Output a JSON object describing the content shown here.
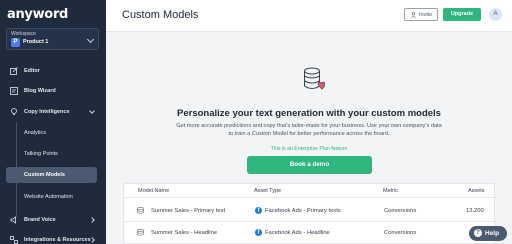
{
  "app": {
    "logo": "anyword"
  },
  "workspace": {
    "label": "Workspace",
    "avatar_letter": "P",
    "name": "Product 1"
  },
  "sidebar": {
    "items": [
      {
        "label": "Editor",
        "icon": "edit-icon"
      },
      {
        "label": "Blog Wizard",
        "icon": "blog-icon"
      },
      {
        "label": "Copy Intelligence",
        "icon": "bulb-icon"
      },
      {
        "label": "Brand Voice",
        "icon": "voice-icon"
      },
      {
        "label": "Integrations & Resources",
        "icon": "integrations-icon"
      }
    ],
    "sub_items": [
      {
        "label": "Analytics"
      },
      {
        "label": "Talking Points"
      },
      {
        "label": "Custom Models"
      },
      {
        "label": "Website Automation"
      }
    ]
  },
  "header": {
    "title": "Custom Models",
    "invite_label": "Invite",
    "upgrade_label": "Upgrade",
    "avatar_letter": "A"
  },
  "hero": {
    "title": "Personalize your text generation with your custom models",
    "description": "Get more accurate predictions and copy that's tailor-made for your business. Use your own company's data to train a Custom Model for better performance across the board.",
    "enterprise_note": "This is an Enterprise Plan feature",
    "cta_label": "Book a demo"
  },
  "table": {
    "columns": [
      "Model Name",
      "Asset Type",
      "Metric",
      "Assets"
    ],
    "rows": [
      {
        "name": "Summer Sales - Primary text",
        "asset_type": "Facebook Ads - Primary texts",
        "metric": "Conversions",
        "assets": "13,200"
      },
      {
        "name": "Summer Sales - Headline",
        "asset_type": "Facebook Ads - Headline",
        "metric": "Conversions",
        "assets": ""
      }
    ]
  },
  "help": {
    "label": "Help"
  },
  "colors": {
    "sidebar_bg": "#1f2a3c",
    "accent_green": "#2fb67c",
    "facebook_blue": "#1877f2"
  }
}
